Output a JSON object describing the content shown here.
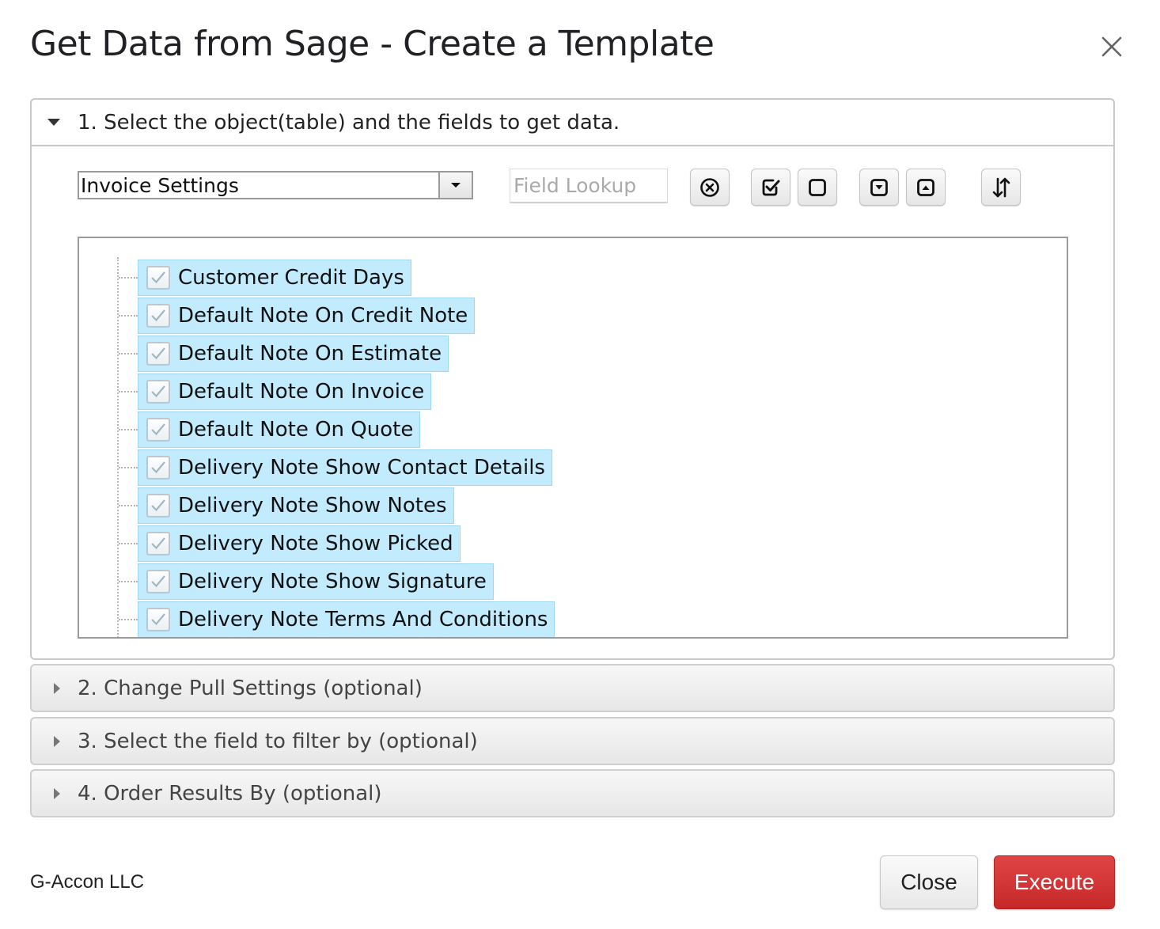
{
  "dialog": {
    "title": "Get Data from Sage - Create a Template",
    "close_icon": "close-icon"
  },
  "section1": {
    "header": "1. Select the object(table) and the fields to get data.",
    "object_select": {
      "value": "Invoice Settings"
    },
    "field_lookup": {
      "placeholder": "Field Lookup",
      "value": ""
    },
    "toolbar": [
      {
        "icon": "clear-circle-x-icon"
      },
      {
        "icon": "check-all-icon"
      },
      {
        "icon": "uncheck-all-icon"
      },
      {
        "icon": "expand-down-icon"
      },
      {
        "icon": "collapse-up-icon"
      },
      {
        "icon": "sort-icon"
      }
    ],
    "fields": [
      {
        "label": "Customer Credit Days",
        "checked": true
      },
      {
        "label": "Default Note On Credit Note",
        "checked": true
      },
      {
        "label": "Default Note On Estimate",
        "checked": true
      },
      {
        "label": "Default Note On Invoice",
        "checked": true
      },
      {
        "label": "Default Note On Quote",
        "checked": true
      },
      {
        "label": "Delivery Note Show Contact Details",
        "checked": true
      },
      {
        "label": "Delivery Note Show Notes",
        "checked": true
      },
      {
        "label": "Delivery Note Show Picked",
        "checked": true
      },
      {
        "label": "Delivery Note Show Signature",
        "checked": true
      },
      {
        "label": "Delivery Note Terms And Conditions",
        "checked": true
      }
    ]
  },
  "section2": {
    "header": "2. Change Pull Settings (optional)"
  },
  "section3": {
    "header": "3. Select the field to filter by (optional)"
  },
  "section4": {
    "header": "4. Order Results By (optional)"
  },
  "footer": {
    "brand": "G-Accon LLC",
    "close_label": "Close",
    "execute_label": "Execute"
  },
  "colors": {
    "execute": "#d33636",
    "selected_item_bg": "#c2ebfd"
  }
}
